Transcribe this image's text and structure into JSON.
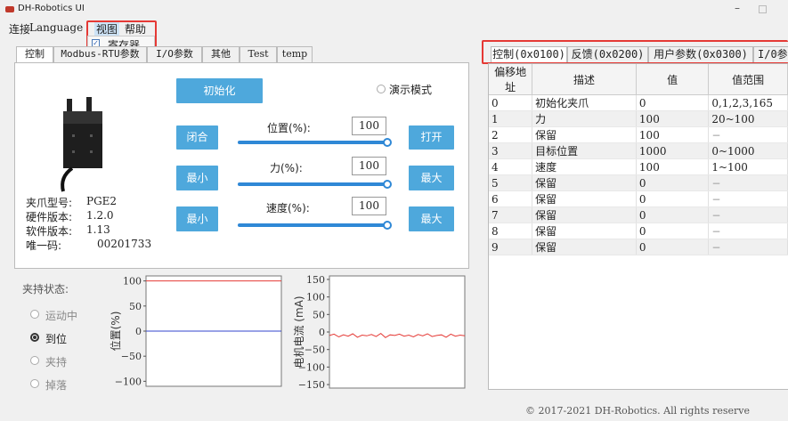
{
  "app": {
    "title": "DH-Robotics UI",
    "minimize": "–"
  },
  "menu": {
    "connect": "连接",
    "language": "Language",
    "view": "视图",
    "help": "帮助",
    "registers": "寄存器",
    "registers_checked": "✓"
  },
  "left_tabs": [
    "控制",
    "Modbus-RTU参数",
    "I/O参数",
    "其他",
    "Test",
    "temp"
  ],
  "control": {
    "init_button": "初始化",
    "demo_mode": "演示模式",
    "close_button": "闭合",
    "open_button": "打开",
    "min_button": "最小",
    "max_button": "最大",
    "position_label": "位置(%):",
    "force_label": "力(%):",
    "speed_label": "速度(%):",
    "position_value": "100",
    "force_value": "100",
    "speed_value": "100",
    "position_pct": 100,
    "force_pct": 100,
    "speed_pct": 100
  },
  "device": {
    "model_label": "夹爪型号:",
    "model": "PGE2",
    "hw_label": "硬件版本:",
    "hw": "1.2.0",
    "sw_label": "软件版本:",
    "sw": "1.13",
    "uid_label": "唯一码:",
    "uid": "00201733"
  },
  "status": {
    "title": "夹持状态:",
    "items": [
      {
        "label": "运动中",
        "on": false
      },
      {
        "label": "到位",
        "on": true
      },
      {
        "label": "夹持",
        "on": false
      },
      {
        "label": "掉落",
        "on": false
      }
    ]
  },
  "charts": {
    "position_ylabel": "位置(%)",
    "current_ylabel": "电机电流 (mA)",
    "position_ticks": [
      "100",
      "50",
      "0",
      "−50",
      "−100"
    ],
    "current_ticks": [
      "150",
      "100",
      "50",
      "0",
      "−50",
      "−100",
      "−150"
    ]
  },
  "chart_data": [
    {
      "type": "line",
      "ylabel": "位置(%)",
      "ylim": [
        -110,
        110
      ],
      "series": [
        {
          "values": [
            100,
            100
          ],
          "color": "#e53935"
        },
        {
          "values": [
            0,
            0
          ],
          "color": "#3344cc"
        }
      ]
    },
    {
      "type": "line",
      "ylabel": "电机电流 (mA)",
      "ylim": [
        -160,
        160
      ],
      "series": [
        {
          "values": [
            -10,
            -6,
            -14,
            -8,
            -12,
            -5,
            -15,
            -9,
            -11,
            -7,
            -13,
            -4,
            -16,
            -8,
            -10,
            -6,
            -12,
            -9,
            -14,
            -7,
            -11,
            -5,
            -13,
            -10,
            -8,
            -15,
            -6,
            -12,
            -9,
            -11
          ],
          "color": "#e53935"
        }
      ]
    }
  ],
  "right_tabs": [
    "控制(0x0100)",
    "反馈(0x0200)",
    "用户参数(0x0300)",
    "I/0参"
  ],
  "table": {
    "headers": [
      "偏移地址",
      "描述",
      "值",
      "值范围"
    ],
    "rows": [
      [
        "0",
        "初始化夹爪",
        "0",
        "0,1,2,3,165"
      ],
      [
        "1",
        "力",
        "100",
        "20~100"
      ],
      [
        "2",
        "保留",
        "100",
        "−"
      ],
      [
        "3",
        "目标位置",
        "1000",
        "0~1000"
      ],
      [
        "4",
        "速度",
        "100",
        "1~100"
      ],
      [
        "5",
        "保留",
        "0",
        "−"
      ],
      [
        "6",
        "保留",
        "0",
        "−"
      ],
      [
        "7",
        "保留",
        "0",
        "−"
      ],
      [
        "8",
        "保留",
        "0",
        "−"
      ],
      [
        "9",
        "保留",
        "0",
        "−"
      ]
    ]
  },
  "footer": "© 2017-2021 DH-Robotics. All rights reserve",
  "colors": {
    "accent": "#4ea8dc",
    "highlight": "#e53935",
    "slider": "#2f88d6"
  }
}
